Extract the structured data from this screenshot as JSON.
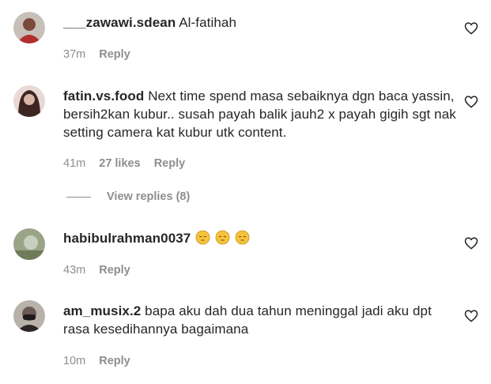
{
  "comments": [
    {
      "username": "___zawawi.sdean",
      "text": "Al-fatihah",
      "time": "37m",
      "likes": "",
      "reply": "Reply",
      "avatar_color": "#8a4b3c"
    },
    {
      "username": "fatin.vs.food",
      "text": "Next time spend masa sebaiknya dgn baca yassin, bersih2kan kubur.. susah payah balik jauh2 x payah gigih sgt nak setting camera kat kubur utk content.",
      "time": "41m",
      "likes": "27 likes",
      "reply": "Reply",
      "avatar_color": "#5b3a35"
    },
    {
      "username": "habibulrahman0037",
      "text": "",
      "time": "43m",
      "likes": "",
      "reply": "Reply",
      "avatar_color": "#7d8a6a",
      "emoji_count": 3,
      "emoji_name": "pensive-face"
    },
    {
      "username": "am_musix.2",
      "text": "bapa aku dah dua tahun meninggal jadi aku dpt rasa kesedihannya bagaimana",
      "time": "10m",
      "likes": "",
      "reply": "Reply",
      "avatar_color": "#3a3331"
    }
  ],
  "view_replies": "View replies (8)",
  "icons": {
    "like": "heart-outline-icon"
  }
}
